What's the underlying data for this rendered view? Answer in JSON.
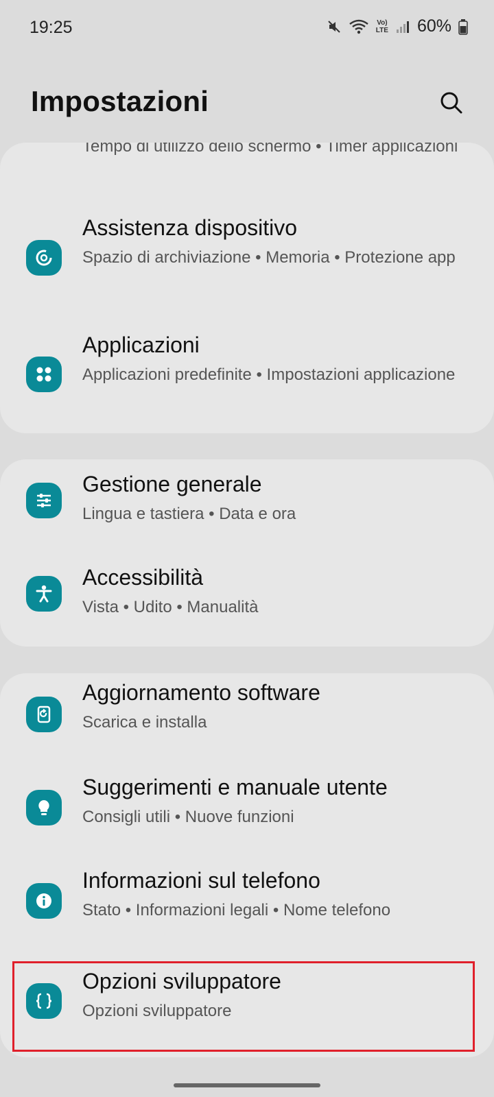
{
  "status_bar": {
    "time": "19:25",
    "battery": "60%",
    "icons": [
      "mute-icon",
      "wifi-icon",
      "volte-icon",
      "signal-icon",
      "battery-icon"
    ],
    "volte_label_top": "Vo)",
    "volte_label_bottom": "LTE"
  },
  "header": {
    "title": "Impostazioni",
    "search_icon": "search-icon"
  },
  "sections": [
    {
      "items": [
        {
          "title": "",
          "subtitle": "Tempo di utilizzo dello schermo • Timer applicazioni"
        },
        {
          "title": "Assistenza dispositivo",
          "subtitle": "Spazio di archiviazione • Memoria • Protezione app",
          "icon": "device-care-icon"
        },
        {
          "title": "Applicazioni",
          "subtitle": "Applicazioni predefinite • Impostazioni applicazione",
          "icon": "apps-icon"
        }
      ]
    },
    {
      "items": [
        {
          "title": "Gestione generale",
          "subtitle": "Lingua e tastiera • Data e ora",
          "icon": "sliders-icon"
        },
        {
          "title": "Accessibilità",
          "subtitle": "Vista • Udito • Manualità",
          "icon": "accessibility-icon"
        }
      ]
    },
    {
      "items": [
        {
          "title": "Aggiornamento software",
          "subtitle": "Scarica e installa",
          "icon": "software-update-icon"
        },
        {
          "title": "Suggerimenti e manuale utente",
          "subtitle": "Consigli utili • Nuove funzioni",
          "icon": "lightbulb-icon"
        },
        {
          "title": "Informazioni sul telefono",
          "subtitle": "Stato • Informazioni legali • Nome telefono",
          "icon": "info-icon"
        },
        {
          "title": "Opzioni sviluppatore",
          "subtitle": "Opzioni sviluppatore",
          "icon": "developer-braces-icon"
        }
      ]
    }
  ],
  "colors": {
    "background": "#dcdcdc",
    "card": "#e7e7e7",
    "icon_accent": "#0a8a97",
    "highlight": "#e0202b"
  }
}
